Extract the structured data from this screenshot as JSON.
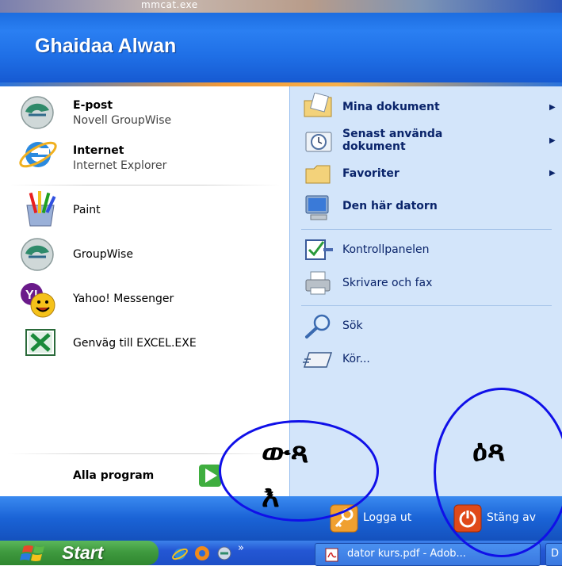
{
  "top_strip": {
    "text": "mmcat.exe"
  },
  "header": {
    "user_name": "Ghaidaa Alwan"
  },
  "left_panel": {
    "pinned": [
      {
        "title": "E-post",
        "subtitle": "Novell GroupWise"
      },
      {
        "title": "Internet",
        "subtitle": "Internet Explorer"
      }
    ],
    "recent": [
      {
        "label": "Paint"
      },
      {
        "label": "GroupWise"
      },
      {
        "label": "Yahoo! Messenger"
      },
      {
        "label": "Genväg till EXCEL.EXE"
      }
    ],
    "all_programs": "Alla program"
  },
  "right_panel": {
    "items": [
      {
        "label": "Mina dokument",
        "submenu": true
      },
      {
        "label": "Senast använda dokument",
        "submenu": true
      },
      {
        "label": "Favoriter",
        "submenu": true
      },
      {
        "label": "Den här datorn"
      },
      {
        "label": "Kontrollpanelen"
      },
      {
        "label": "Skrivare och fax"
      },
      {
        "label": "Sök"
      },
      {
        "label": "Kör..."
      }
    ]
  },
  "bottom_bar": {
    "logoff": "Logga ut",
    "shutdown": "Stäng av"
  },
  "taskbar": {
    "start": "Start",
    "chevron": "»",
    "task_label": "dator kurs.pdf - Adob...",
    "next_task": "D"
  },
  "annotations": {
    "left_text_line1": "ውጻ",
    "left_text_line2": "እ",
    "right_text": "ዕጻ"
  },
  "colors": {
    "header_blue": "#1f6fe6",
    "right_panel": "#d3e5fa",
    "start_green": "#3f9a3f",
    "annotation_blue": "#1010e8",
    "logoff_orange": "#f0a030",
    "shutdown_red": "#e04a1a"
  }
}
